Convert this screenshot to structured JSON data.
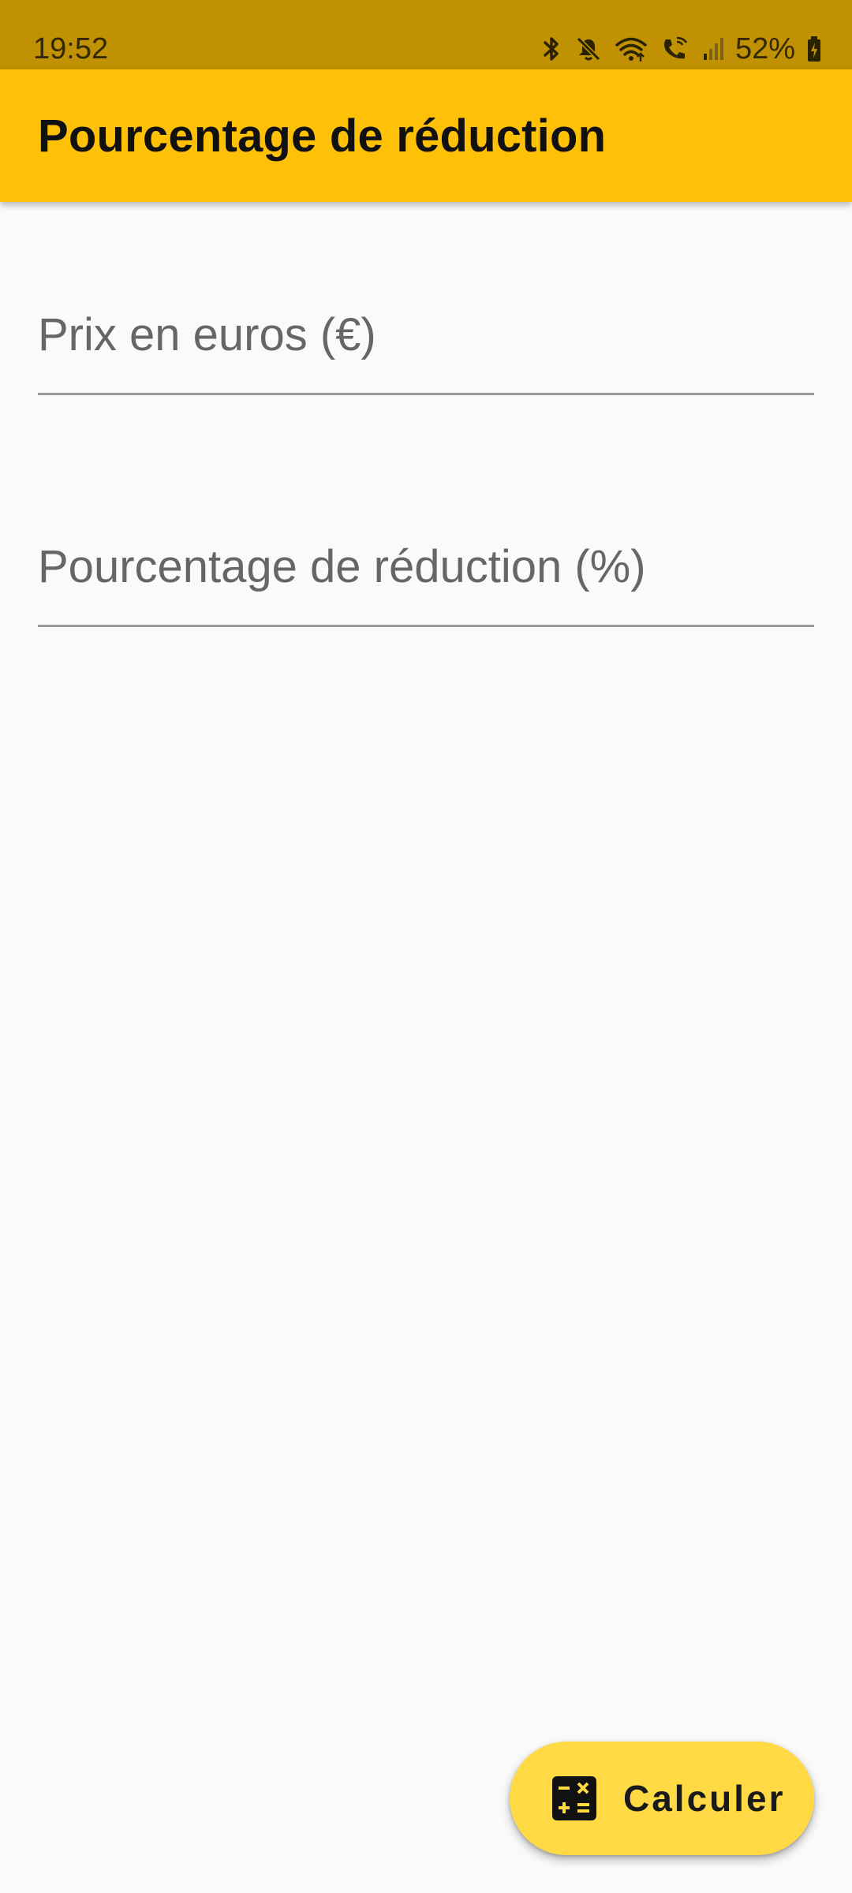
{
  "status_bar": {
    "time": "19:52",
    "battery": "52%",
    "icons": [
      "bluetooth-icon",
      "mute-icon",
      "wifi-icon",
      "wifi-calling-icon",
      "signal-icon",
      "battery-icon"
    ]
  },
  "app_bar": {
    "title": "Pourcentage de réduction",
    "color": "#ffc107"
  },
  "form": {
    "price_field": {
      "placeholder": "Prix en euros (€)",
      "value": ""
    },
    "discount_field": {
      "placeholder": "Pourcentage de réduction (%)",
      "value": ""
    }
  },
  "fab": {
    "label": "Calculer",
    "icon": "calculate-icon",
    "color": "#ffda44"
  }
}
